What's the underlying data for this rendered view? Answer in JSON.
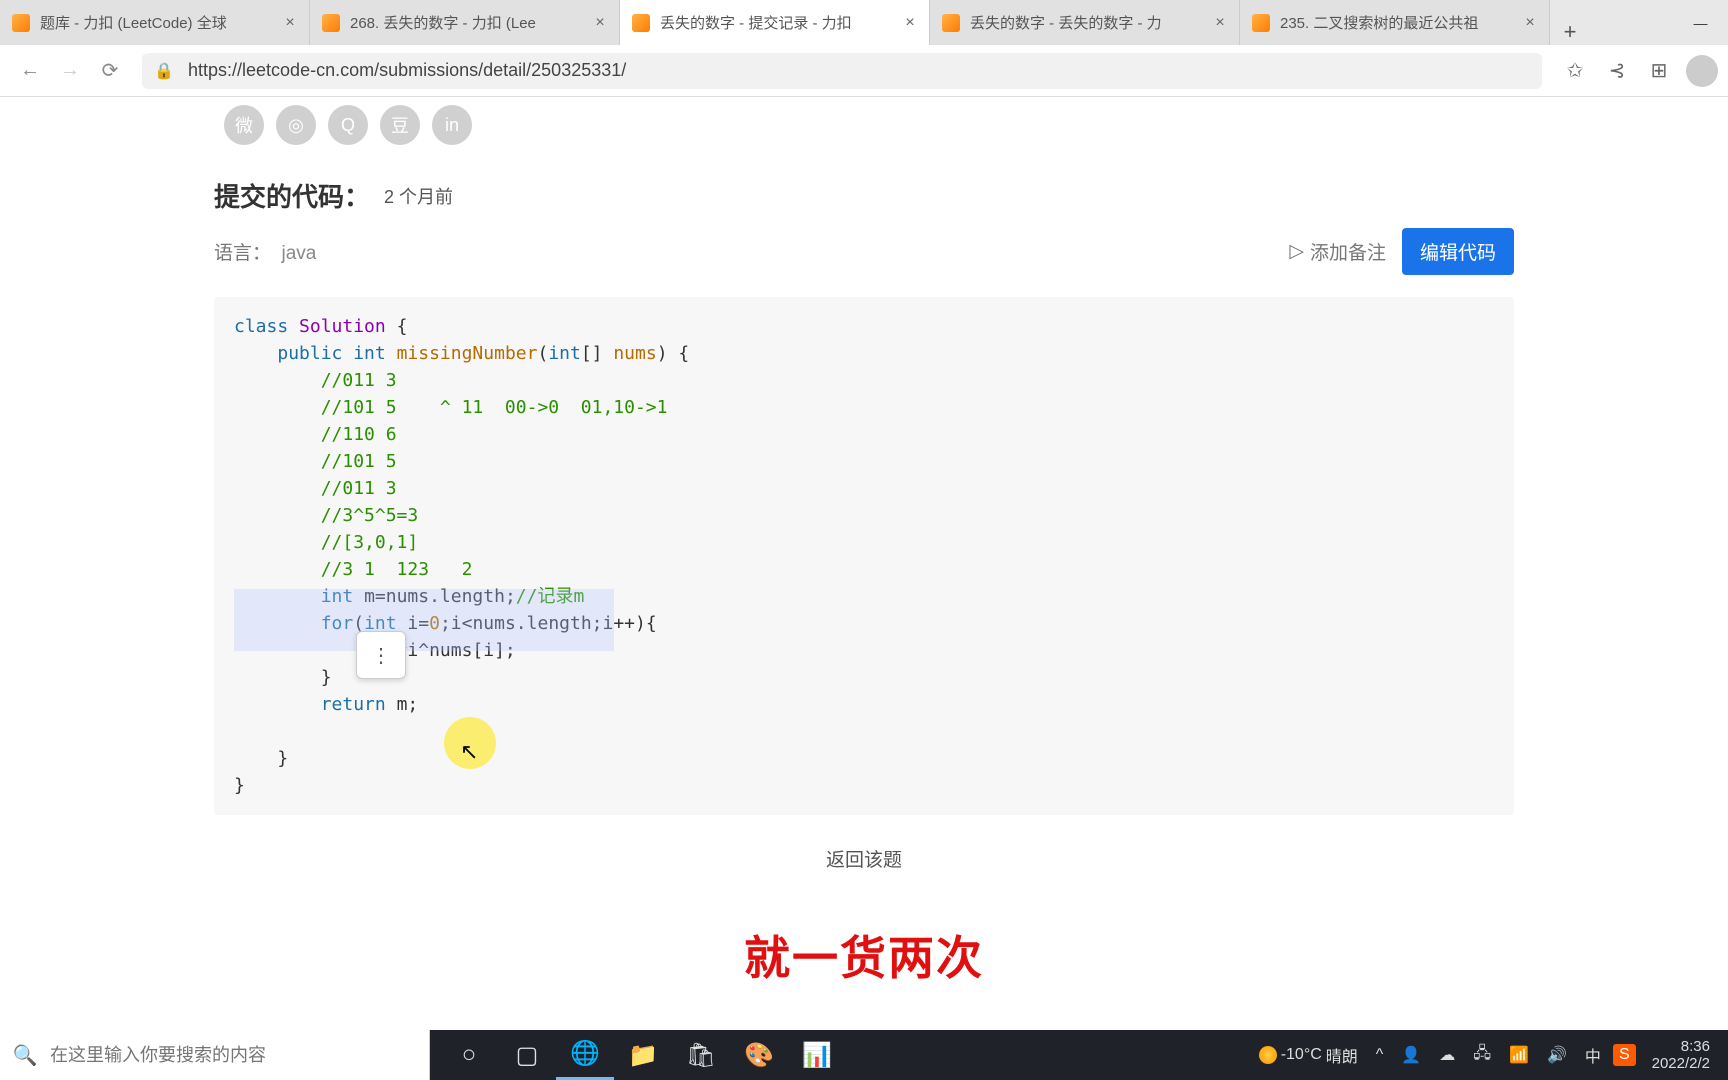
{
  "browser": {
    "tabs": [
      {
        "title": "题库 - 力扣 (LeetCode) 全球",
        "favicon": "leetcode"
      },
      {
        "title": "268. 丢失的数字 - 力扣 (Lee",
        "favicon": "leetcode"
      },
      {
        "title": "丢失的数字 - 提交记录 - 力扣",
        "favicon": "leetcode",
        "active": true
      },
      {
        "title": "丢失的数字 - 丢失的数字 - 力",
        "favicon": "leetcode"
      },
      {
        "title": "235. 二叉搜索树的最近公共祖",
        "favicon": "leetcode"
      }
    ],
    "url": "https://leetcode-cn.com/submissions/detail/250325331/"
  },
  "share_icons": [
    "wechat",
    "weibo",
    "qq",
    "douban",
    "linkedin"
  ],
  "submission": {
    "heading": "提交的代码：",
    "time": "2 个月前",
    "lang_label": "语言：",
    "lang_value": "java",
    "add_note": "添加备注",
    "edit_button": "编辑代码"
  },
  "code": {
    "lines": [
      {
        "t": "class ",
        "c": "blue",
        "s": "Solution",
        "c2": "purple",
        "r": " {"
      },
      {
        "indent": 1,
        "segs": [
          [
            "public ",
            "blue"
          ],
          [
            "int ",
            "blue"
          ],
          [
            "missingNumber",
            "orange"
          ],
          [
            "(",
            "plain"
          ],
          [
            "int",
            "blue"
          ],
          [
            "[] ",
            "plain"
          ],
          [
            "nums",
            "orange"
          ],
          [
            ") {",
            "plain"
          ]
        ]
      },
      {
        "indent": 2,
        "segs": [
          [
            "//011 3",
            "green"
          ]
        ]
      },
      {
        "indent": 2,
        "segs": [
          [
            "//101 5    ^ 11  00->0  01,10->1",
            "green"
          ]
        ]
      },
      {
        "indent": 2,
        "segs": [
          [
            "//110 6",
            "green"
          ]
        ]
      },
      {
        "indent": 2,
        "segs": [
          [
            "//101 5",
            "green"
          ]
        ]
      },
      {
        "indent": 2,
        "segs": [
          [
            "//011 3",
            "green"
          ]
        ]
      },
      {
        "indent": 2,
        "segs": [
          [
            "//3^5^5=3",
            "green"
          ]
        ]
      },
      {
        "indent": 2,
        "segs": [
          [
            "//[3,0,1]",
            "green"
          ]
        ]
      },
      {
        "indent": 2,
        "segs": [
          [
            "//3 1  123   2",
            "green"
          ]
        ]
      },
      {
        "indent": 2,
        "segs": [
          [
            "int ",
            "blue"
          ],
          [
            "m=nums.length;",
            "plain"
          ],
          [
            "//记录m",
            "green"
          ]
        ]
      },
      {
        "indent": 2,
        "segs": [
          [
            "for",
            "blue"
          ],
          [
            "(",
            "plain"
          ],
          [
            "int ",
            "blue"
          ],
          [
            "i=",
            "plain"
          ],
          [
            "0",
            "orange"
          ],
          [
            ";i<nums.length;i++){",
            "plain"
          ]
        ]
      },
      {
        "indent": 3,
        "segs": [
          [
            "m=m^i^nums[i];",
            "plain"
          ]
        ]
      },
      {
        "indent": 2,
        "segs": [
          [
            "}",
            "plain"
          ]
        ]
      },
      {
        "indent": 2,
        "segs": [
          [
            "return ",
            "blue"
          ],
          [
            "m;",
            "plain"
          ]
        ]
      },
      {
        "indent": 0,
        "segs": [
          [
            "",
            "plain"
          ]
        ]
      },
      {
        "indent": 1,
        "segs": [
          [
            "}",
            "plain"
          ]
        ]
      },
      {
        "indent": 0,
        "segs": [
          [
            "}",
            "plain"
          ]
        ]
      }
    ]
  },
  "back_link": "返回该题",
  "caption": "就一货两次",
  "taskbar": {
    "search_placeholder": "在这里输入你要搜索的内容",
    "weather_temp": "-10°C",
    "weather_text": "晴朗",
    "ime": "中",
    "time": "8:36",
    "date": "2022/2/2"
  }
}
